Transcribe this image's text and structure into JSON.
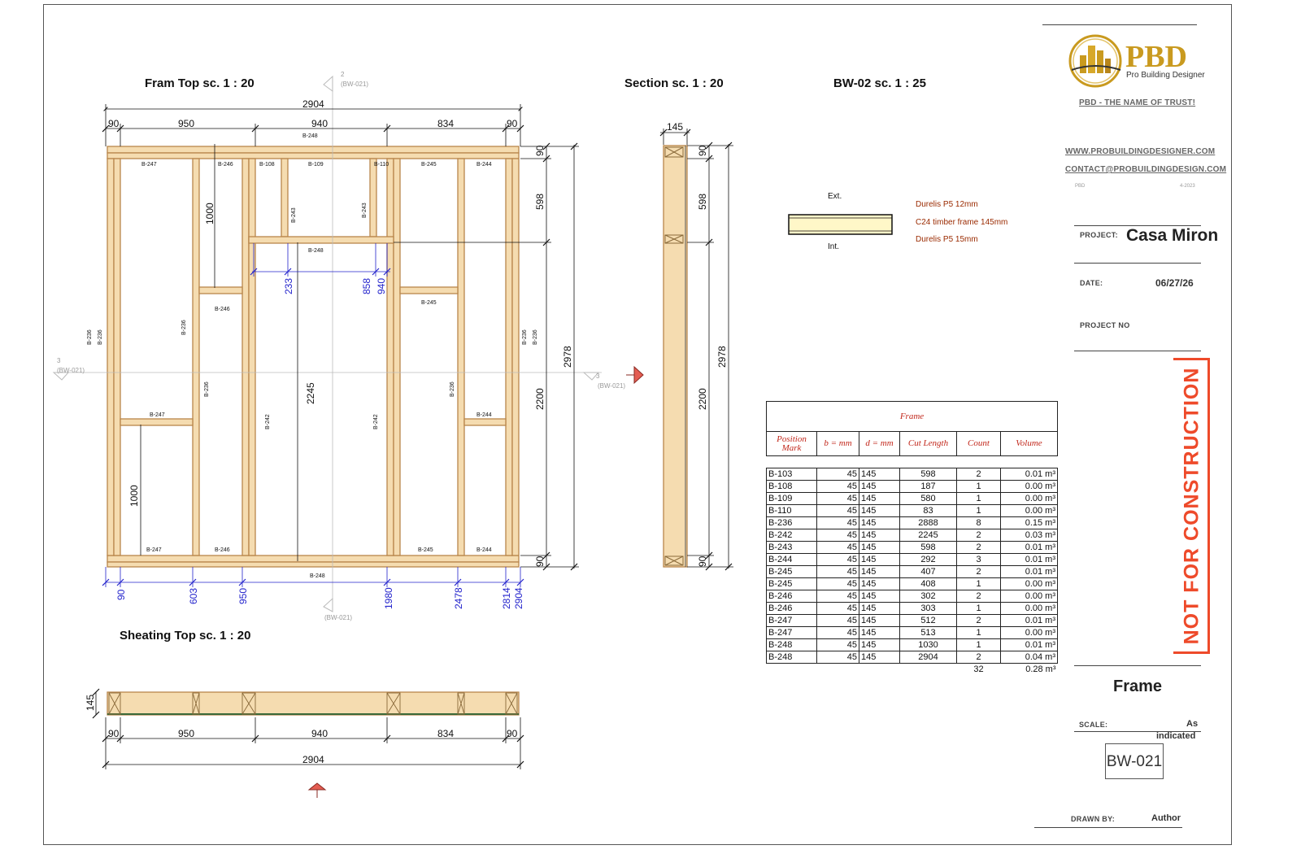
{
  "views": {
    "plan_title": "Fram Top sc. 1 : 20",
    "section_title": "Section sc. 1 : 20",
    "bw_title": "BW-02 sc. 1 : 25",
    "sheathing_title": "Sheating Top sc. 1 : 20"
  },
  "plan": {
    "overall_width": "2904",
    "top_segments": [
      "90",
      "950",
      "940",
      "834",
      "90"
    ],
    "right_dims": [
      "90",
      "598",
      "2200",
      "90"
    ],
    "right_total": "2978",
    "bottom_dims": [
      "90",
      "603",
      "950",
      "1980",
      "2478",
      "2814",
      "2904"
    ],
    "inner_dims": [
      "1000",
      "233",
      "858",
      "940",
      "2245",
      "1000"
    ],
    "section_marker_num_top": "2",
    "section_marker_ref_top": "(BW-021)",
    "section_marker_num_left": "3",
    "section_marker_ref_left": "(BW-021)",
    "section_marker_num_right": "3",
    "section_marker_ref_right": "(BW-021)",
    "section_marker_ref_bottom": "(BW-021)",
    "tags": {
      "top_plate": "B-248",
      "bottom_plate": "B-248",
      "header": "B-248",
      "t247": "B-247",
      "t246": "B-246",
      "t108": "B-108",
      "t109": "B-109",
      "t110": "B-110",
      "t245": "B-245",
      "t244": "B-244",
      "t243": "B-243",
      "t236": "B-236",
      "t242": "B-242"
    }
  },
  "section": {
    "top_width": "145",
    "dims": [
      "90",
      "598",
      "2200",
      "90"
    ],
    "total": "2978"
  },
  "sheathing": {
    "height": "145",
    "segments": [
      "90",
      "950",
      "940",
      "834",
      "90"
    ],
    "total": "2904"
  },
  "legend": {
    "ext": "Ext.",
    "int": "Int.",
    "layer1": "Durelis P5 12mm",
    "layer2": "C24 timber frame 145mm",
    "layer3": "Durelis P5 15mm"
  },
  "schedule": {
    "title": "Frame",
    "headers": [
      "Position Mark",
      "b = mm",
      "d = mm",
      "Cut Length",
      "Count",
      "Volume"
    ],
    "rows": [
      [
        "B-103",
        "45",
        "145",
        "598",
        "2",
        "0.01 m³"
      ],
      [
        "B-108",
        "45",
        "145",
        "187",
        "1",
        "0.00 m³"
      ],
      [
        "B-109",
        "45",
        "145",
        "580",
        "1",
        "0.00 m³"
      ],
      [
        "B-110",
        "45",
        "145",
        "83",
        "1",
        "0.00 m³"
      ],
      [
        "B-236",
        "45",
        "145",
        "2888",
        "8",
        "0.15 m³"
      ],
      [
        "B-242",
        "45",
        "145",
        "2245",
        "2",
        "0.03 m³"
      ],
      [
        "B-243",
        "45",
        "145",
        "598",
        "2",
        "0.01 m³"
      ],
      [
        "B-244",
        "45",
        "145",
        "292",
        "3",
        "0.01 m³"
      ],
      [
        "B-245",
        "45",
        "145",
        "407",
        "2",
        "0.01 m³"
      ],
      [
        "B-245",
        "45",
        "145",
        "408",
        "1",
        "0.00 m³"
      ],
      [
        "B-246",
        "45",
        "145",
        "302",
        "2",
        "0.00 m³"
      ],
      [
        "B-246",
        "45",
        "145",
        "303",
        "1",
        "0.00 m³"
      ],
      [
        "B-247",
        "45",
        "145",
        "512",
        "2",
        "0.01 m³"
      ],
      [
        "B-247",
        "45",
        "145",
        "513",
        "1",
        "0.00 m³"
      ],
      [
        "B-248",
        "45",
        "145",
        "1030",
        "1",
        "0.01 m³"
      ],
      [
        "B-248",
        "45",
        "145",
        "2904",
        "2",
        "0.04 m³"
      ]
    ],
    "total_count": "32",
    "total_volume": "0.28 m³"
  },
  "titleblock": {
    "logo_text": "PBD",
    "logo_sub": "Pro Building Designer",
    "slogan": "PBD - THE NAME OF TRUST!",
    "website": "WWW.PROBUILDINGDESIGNER.COM",
    "email": "CONTACT@PROBUILDINGDESIGN.COM",
    "small_left": "PBD",
    "small_right": "4-2023",
    "project_label": "PROJECT:",
    "project_value": "Casa Miron",
    "date_label": "DATE:",
    "date_value": "06/27/26",
    "project_no_label": "PROJECT NO",
    "stamp": "NOT FOR CONSTRUCTION",
    "sheet_name": "Frame",
    "scale_label": "SCALE:",
    "scale_value_1": "As",
    "scale_value_2": "indicated",
    "sheet_number": "BW-021",
    "drawn_by_label": "DRAWN BY:",
    "drawn_by_value": "Author"
  },
  "colors": {
    "timber": "#f5dcb0",
    "timber_edge": "#b8864c",
    "stamp": "#ee4a2a",
    "table_header": "#c2281c",
    "blue_dim": "#2222cc",
    "logo_gold": "#c99a1f"
  }
}
